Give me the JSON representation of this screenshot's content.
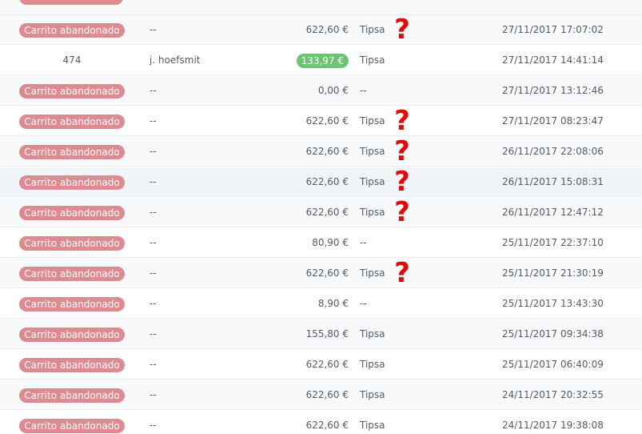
{
  "rows": [
    {
      "status": "Carrito abandonado",
      "customer": "--",
      "total": "622,60 €",
      "payment": "Tipsa",
      "question": "?",
      "date": "27/11/2017 17:07:02"
    },
    {
      "id": "474",
      "customer": "j. hoefsmit",
      "total": "133,97 €",
      "payment": "Tipsa",
      "date": "27/11/2017 14:41:14"
    },
    {
      "status": "Carrito abandonado",
      "customer": "--",
      "total": "0,00 €",
      "payment": "--",
      "date": "27/11/2017 13:12:46"
    },
    {
      "status": "Carrito abandonado",
      "customer": "--",
      "total": "622,60 €",
      "payment": "Tipsa",
      "question": "?",
      "date": "27/11/2017 08:23:47"
    },
    {
      "status": "Carrito abandonado",
      "customer": "--",
      "total": "622,60 €",
      "payment": "Tipsa",
      "question": "?",
      "date": "26/11/2017 22:08:06"
    },
    {
      "status": "Carrito abandonado",
      "customer": "--",
      "total": "622,60 €",
      "payment": "Tipsa",
      "question": "?",
      "date": "26/11/2017 15:08:31"
    },
    {
      "status": "Carrito abandonado",
      "customer": "--",
      "total": "622,60 €",
      "payment": "Tipsa",
      "question": "?",
      "date": "26/11/2017 12:47:12"
    },
    {
      "status": "Carrito abandonado",
      "customer": "--",
      "total": "80,90 €",
      "payment": "--",
      "date": "25/11/2017 22:37:10"
    },
    {
      "status": "Carrito abandonado",
      "customer": "--",
      "total": "622,60 €",
      "payment": "Tipsa",
      "question": "?",
      "date": "25/11/2017 21:30:19"
    },
    {
      "status": "Carrito abandonado",
      "customer": "--",
      "total": "8,90 €",
      "payment": "--",
      "date": "25/11/2017 13:43:30"
    },
    {
      "status": "Carrito abandonado",
      "customer": "--",
      "total": "155,80 €",
      "payment": "Tipsa",
      "date": "25/11/2017 09:34:38"
    },
    {
      "status": "Carrito abandonado",
      "customer": "--",
      "total": "622,60 €",
      "payment": "Tipsa",
      "date": "25/11/2017 06:40:09"
    },
    {
      "status": "Carrito abandonado",
      "customer": "--",
      "total": "622,60 €",
      "payment": "Tipsa",
      "date": "24/11/2017 20:32:55"
    },
    {
      "status": "Carrito abandonado",
      "customer": "--",
      "total": "622,60 €",
      "payment": "Tipsa",
      "date": "24/11/2017 19:38:08"
    }
  ],
  "colors": {
    "abandoned_badge": "#de8a91",
    "total_badge": "#6cc371",
    "question_mark": "#e00a0a",
    "row_alt": "#f7f9fb",
    "row_plain": "#ffffff"
  }
}
